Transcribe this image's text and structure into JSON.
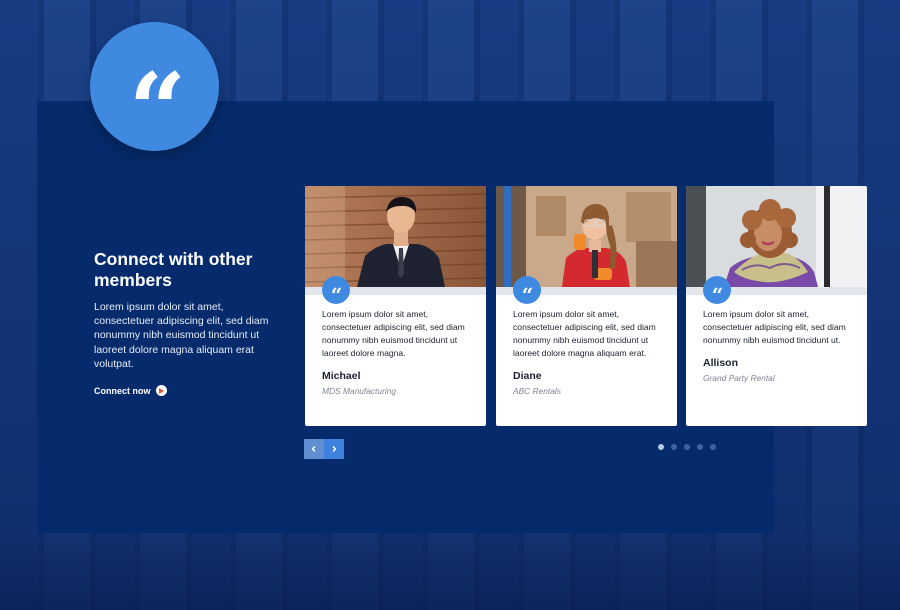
{
  "section": {
    "quote_glyph": "“",
    "heading": "Connect with other members",
    "body": "Lorem ipsum dolor sit amet, consectetuer adipiscing elit, sed diam nonummy nibh euismod tincidunt ut laoreet dolore magna aliquam erat volutpat.",
    "cta_label": "Connect now"
  },
  "testimonials": [
    {
      "text": "Lorem ipsum dolor sit amet, consectetuer adipiscing elit, sed diam nonummy nibh euismod tincidunt ut laoreet dolore magna.",
      "name": "Michael",
      "company": "MDS Manufacturing"
    },
    {
      "text": "Lorem ipsum dolor sit amet, consectetuer adipiscing elit, sed diam nonummy nibh euismod tincidunt ut laoreet dolore magna aliquam erat.",
      "name": "Diane",
      "company": "ABC Rentals"
    },
    {
      "text": "Lorem ipsum dolor sit amet, consectetuer adipiscing elit, sed diam nonummy nibh euismod tincidunt ut.",
      "name": "Allison",
      "company": "Grand Party Rental"
    }
  ],
  "carousel": {
    "prev_icon": "chevron-left-icon",
    "next_icon": "chevron-right-icon",
    "dot_count": 5,
    "active_dot": 1
  },
  "colors": {
    "panel": "#052b6c",
    "accent": "#3f8ae0",
    "cta_icon": "#e2553c"
  }
}
